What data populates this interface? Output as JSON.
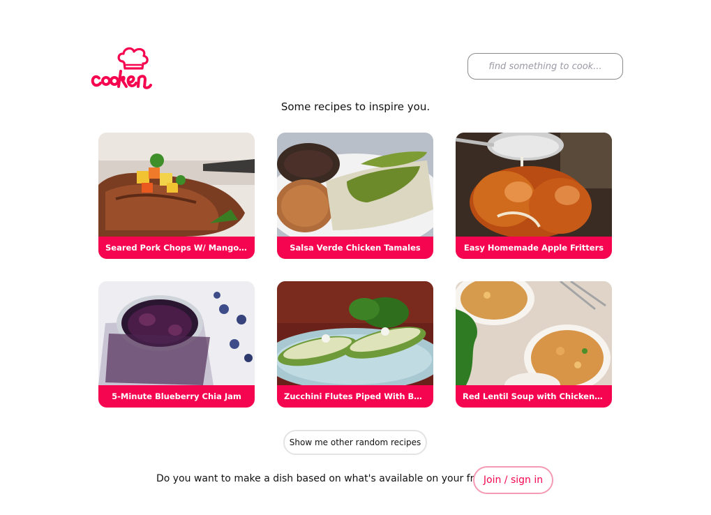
{
  "brand": {
    "name": "cooken",
    "color": "#f5054f"
  },
  "search": {
    "placeholder": "find something to cook..."
  },
  "intro_text": "Some recipes to inspire you.",
  "recipes": [
    {
      "title": "Seared Pork Chops W/ Mango Sa..."
    },
    {
      "title": "Salsa Verde Chicken Tamales"
    },
    {
      "title": "Easy Homemade Apple Fritters"
    },
    {
      "title": "5-Minute Blueberry Chia Jam"
    },
    {
      "title": "Zucchini Flutes Piped With Basil ..."
    },
    {
      "title": "Red Lentil Soup with Chicken an..."
    }
  ],
  "shuffle_button": {
    "label": "Show me other random recipes"
  },
  "fridge_prompt": "Do you want to make a dish based on what's available on your fridge?",
  "join_button": {
    "label": "Join / sign in"
  },
  "colors": {
    "accent": "#f5054f",
    "join_border": "#f59ab4"
  }
}
